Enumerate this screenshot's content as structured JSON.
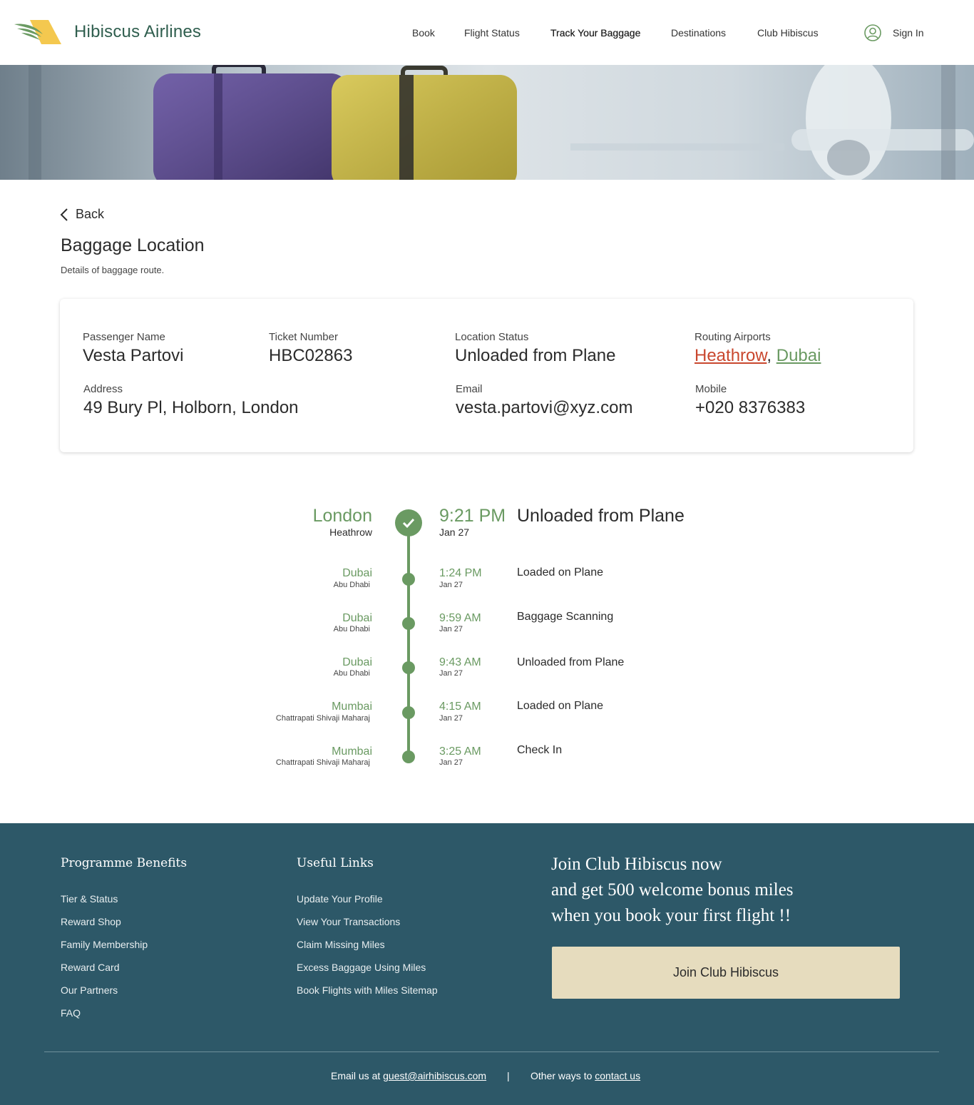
{
  "brand": {
    "name": "Hibiscus Airlines",
    "accent": "#2f5e4e",
    "logo_yellow": "#f4c84f"
  },
  "nav": {
    "items": [
      {
        "label": "Book"
      },
      {
        "label": "Flight Status"
      },
      {
        "label": "Track Your Baggage",
        "active": true
      },
      {
        "label": "Destinations"
      },
      {
        "label": "Club Hibiscus"
      }
    ],
    "sign_in": "Sign In",
    "user_icon": "user-circle-icon"
  },
  "main": {
    "back_label": "Back",
    "title": "Baggage Location",
    "subtitle": "Details of baggage route."
  },
  "details": {
    "passenger_label": "Passenger Name",
    "passenger_value": "Vesta Partovi",
    "ticket_label": "Ticket Number",
    "ticket_value": "HBC02863",
    "status_label": "Location Status",
    "status_value": "Unloaded from Plane",
    "routing_label": "Routing Airports",
    "routing": [
      "Heathrow",
      "Dubai"
    ],
    "routing_separator": ",",
    "address_label": "Address",
    "address_value": "49 Bury Pl, Holborn, London",
    "email_label": "Email",
    "email_value": "vesta.partovi@xyz.com",
    "mobile_label": "Mobile",
    "mobile_value": "+020 8376383"
  },
  "timeline": [
    {
      "city": "London",
      "airport": "Heathrow",
      "time": "9:21 PM",
      "date": "Jan 27",
      "status": "Unloaded from Plane",
      "current": true
    },
    {
      "city": "Dubai",
      "airport": "Abu Dhabi",
      "time": "1:24 PM",
      "date": "Jan 27",
      "status": "Loaded on Plane"
    },
    {
      "city": "Dubai",
      "airport": "Abu Dhabi",
      "time": "9:59 AM",
      "date": "Jan 27",
      "status": "Baggage Scanning"
    },
    {
      "city": "Dubai",
      "airport": "Abu Dhabi",
      "time": "9:43 AM",
      "date": "Jan 27",
      "status": "Unloaded from Plane"
    },
    {
      "city": "Mumbai",
      "airport": "Chattrapati Shivaji Maharaj",
      "time": "4:15 AM",
      "date": "Jan 27",
      "status": "Loaded on Plane"
    },
    {
      "city": "Mumbai",
      "airport": "Chattrapati Shivaji Maharaj",
      "time": "3:25 AM",
      "date": "Jan 27",
      "status": "Check In"
    }
  ],
  "colors": {
    "timeline_green": "#6a9a62",
    "footer_bg": "#2d5868",
    "button_bg": "#e6dcbe",
    "route_red": "#c9472e"
  },
  "footer": {
    "benefits_heading": "Programme Benefits",
    "benefits": [
      "Tier & Status",
      "Reward Shop",
      "Family Membership",
      "Reward Card",
      "Our Partners",
      "FAQ"
    ],
    "links_heading": "Useful Links",
    "links": [
      "Update Your Profile",
      "View Your Transactions",
      "Claim Missing Miles",
      "Excess Baggage Using Miles",
      "Book Flights with Miles Sitemap"
    ],
    "promo_lines": [
      "Join Club Hibiscus now",
      "and get 500 welcome bonus miles",
      "when you book your first flight !!"
    ],
    "join_button": "Join Club Hibiscus",
    "email_prefix": "Email us at",
    "email_link": "guest@airhibiscus.com",
    "separator": "|",
    "contact_prefix": "Other ways to",
    "contact_link": "contact us"
  }
}
